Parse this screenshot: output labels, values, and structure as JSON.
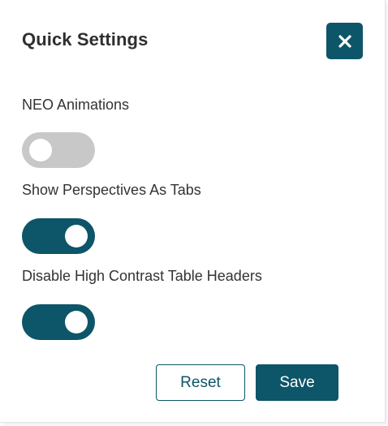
{
  "panel": {
    "title": "Quick Settings",
    "close_icon": "close-icon"
  },
  "settings": [
    {
      "label": "NEO Animations",
      "enabled": false
    },
    {
      "label": "Show Perspectives As Tabs",
      "enabled": true
    },
    {
      "label": "Disable High Contrast Table Headers",
      "enabled": true
    }
  ],
  "actions": {
    "reset_label": "Reset",
    "save_label": "Save"
  },
  "colors": {
    "accent": "#0d5568",
    "toggle_off": "#c8c8c8",
    "text": "#333333"
  }
}
